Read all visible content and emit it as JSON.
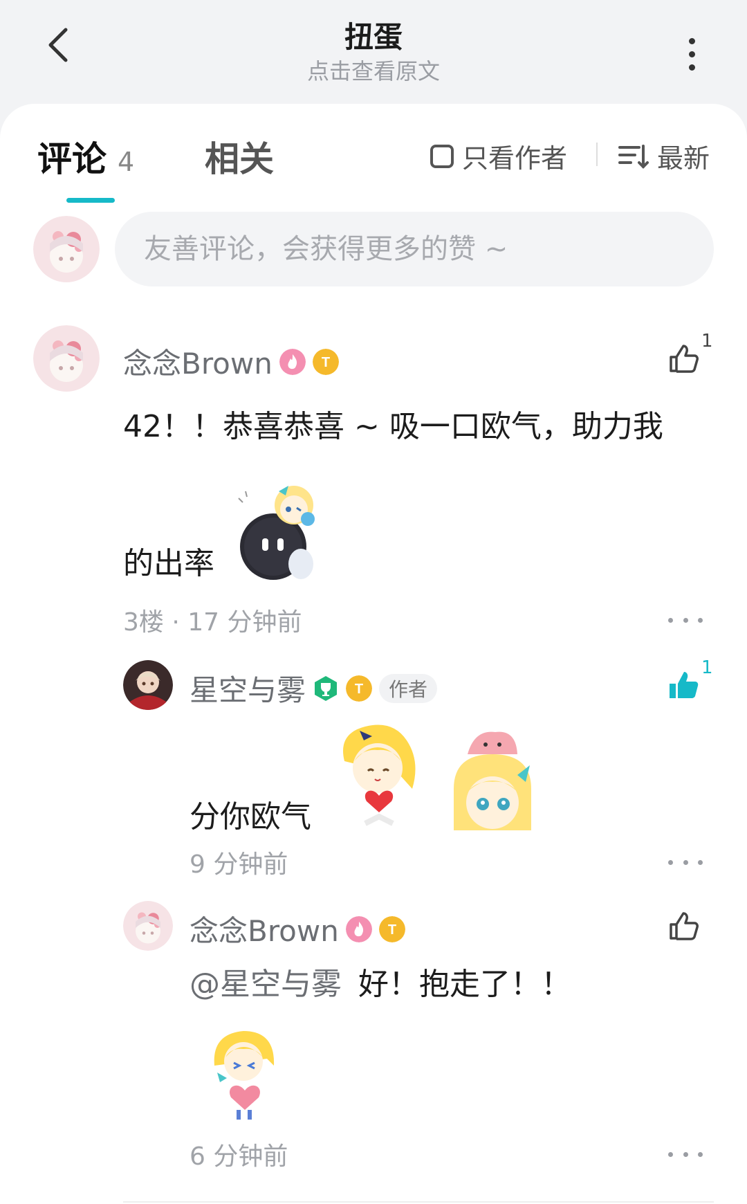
{
  "header": {
    "title": "扭蛋",
    "subtitle": "点击查看原文"
  },
  "tabs": {
    "comment_label": "评论",
    "comment_count": "4",
    "related_label": "相关",
    "author_only_label": "只看作者",
    "sort_label": "最新"
  },
  "input": {
    "placeholder": "友善评论，会获得更多的赞 ~"
  },
  "colors": {
    "accent": "#16b9c8",
    "liked": "#16b9c8"
  },
  "comments": [
    {
      "username": "念念Brown",
      "content_line1": "42！！恭喜恭喜 ~ 吸一口欧气，助力我",
      "content_line2": "的出率",
      "meta": "3楼 · 17 分钟前",
      "like_count": "1",
      "liked": false,
      "sticker": "robot-with-girl-sticker"
    },
    {
      "username": "星空与雾",
      "author_tag": "作者",
      "content": "分你欧气",
      "meta": "9 分钟前",
      "like_count": "1",
      "liked": true,
      "stickers": [
        "girl-heart-sticker",
        "girl-slime-sticker"
      ]
    },
    {
      "username": "念念Brown",
      "mention": "@星空与雾",
      "content": "好！抱走了！！",
      "meta": "6 分钟前",
      "liked": false,
      "sticker": "girl-hug-heart-sticker"
    }
  ]
}
